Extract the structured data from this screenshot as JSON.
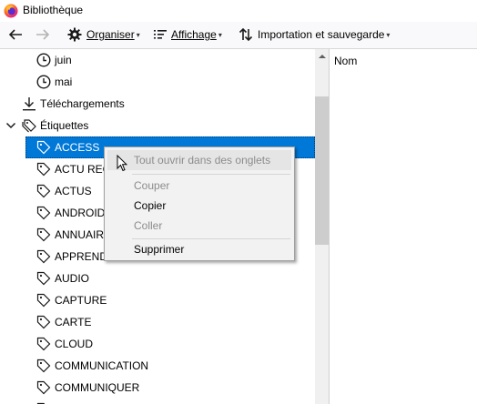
{
  "window": {
    "title": "Bibliothèque"
  },
  "toolbar": {
    "organiser": {
      "label": "Organiser"
    },
    "affichage": {
      "label": "Affichage"
    },
    "import": {
      "label": "Importation et sauvegarde"
    }
  },
  "tree": {
    "items": [
      {
        "label": "juin",
        "icon": "clock-icon"
      },
      {
        "label": "mai",
        "icon": "clock-icon"
      },
      {
        "label": "Téléchargements",
        "icon": "download-icon"
      },
      {
        "label": "Étiquettes",
        "icon": "tags-icon",
        "expanded": true
      },
      {
        "label": "ACCESS",
        "icon": "tag-icon",
        "selected": true
      },
      {
        "label": "ACTU REG",
        "icon": "tag-icon"
      },
      {
        "label": "ACTUS",
        "icon": "tag-icon"
      },
      {
        "label": "ANDROID",
        "icon": "tag-icon"
      },
      {
        "label": "ANNUAIR",
        "icon": "tag-icon"
      },
      {
        "label": "APPREND",
        "icon": "tag-icon"
      },
      {
        "label": "AUDIO",
        "icon": "tag-icon"
      },
      {
        "label": "CAPTURE",
        "icon": "tag-icon"
      },
      {
        "label": "CARTE",
        "icon": "tag-icon"
      },
      {
        "label": "CLOUD",
        "icon": "tag-icon"
      },
      {
        "label": "COMMUNICATION",
        "icon": "tag-icon"
      },
      {
        "label": "COMMUNIQUER",
        "icon": "tag-icon"
      }
    ]
  },
  "details": {
    "column_header": "Nom"
  },
  "context_menu": {
    "items": [
      {
        "label": "Tout ouvrir dans des onglets",
        "disabled": true
      },
      {
        "label": "Couper",
        "disabled": true
      },
      {
        "label": "Copier",
        "disabled": false
      },
      {
        "label": "Coller",
        "disabled": true
      },
      {
        "label": "Supprimer",
        "disabled": false
      }
    ]
  },
  "colors": {
    "selection": "#0078d7",
    "toolbar_bg": "#f9f9fb",
    "menu_bg": "#f2f2f2"
  }
}
